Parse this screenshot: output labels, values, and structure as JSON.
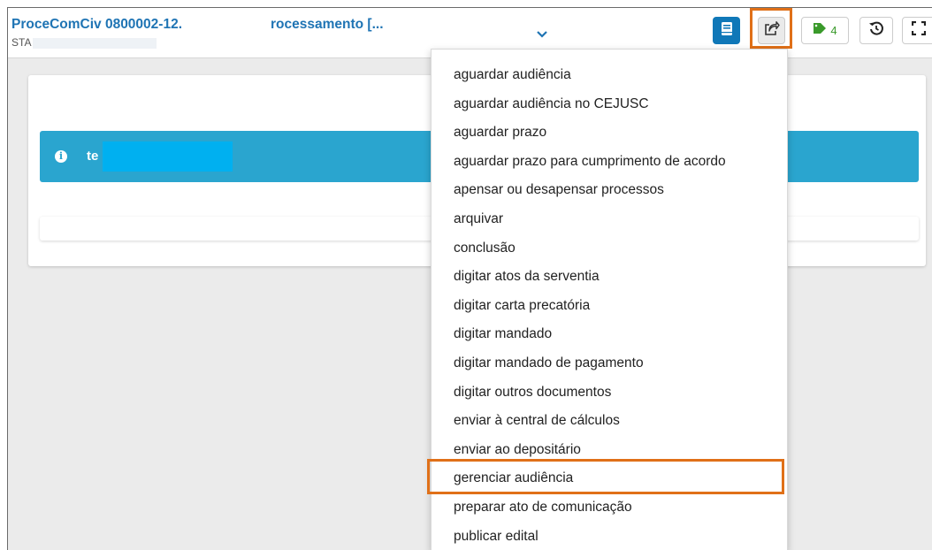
{
  "header": {
    "title_start": "ProceComCiv 0800002-12.",
    "title_end": "rocessamento [...",
    "subtitle": "STA"
  },
  "toolbar": {
    "book_icon": "book-icon",
    "share_icon": "share-icon",
    "tag_icon": "tag-icon",
    "tag_count": "4",
    "history_icon": "history-icon",
    "expand_icon": "expand-icon",
    "chevron_icon": "chevron-down-icon"
  },
  "alert": {
    "text": "te"
  },
  "menu": {
    "items": [
      "aguardar audiência",
      "aguardar audiência no CEJUSC",
      "aguardar prazo",
      "aguardar prazo para cumprimento de acordo",
      "apensar ou desapensar processos",
      "arquivar",
      "conclusão",
      "digitar atos da serventia",
      "digitar carta precatória",
      "digitar mandado",
      "digitar mandado de pagamento",
      "digitar outros documentos",
      "enviar à central de cálculos",
      "enviar ao depositário",
      "gerenciar audiência",
      "preparar ato de comunicação",
      "publicar edital"
    ],
    "highlighted_item": "gerenciar audiência"
  },
  "colors": {
    "title_blue": "#1f74b4",
    "alert_blue": "#2aa5cf",
    "highlight_orange": "#e07018",
    "tag_green": "#3a9a2b",
    "book_button_blue": "#1078b8"
  }
}
